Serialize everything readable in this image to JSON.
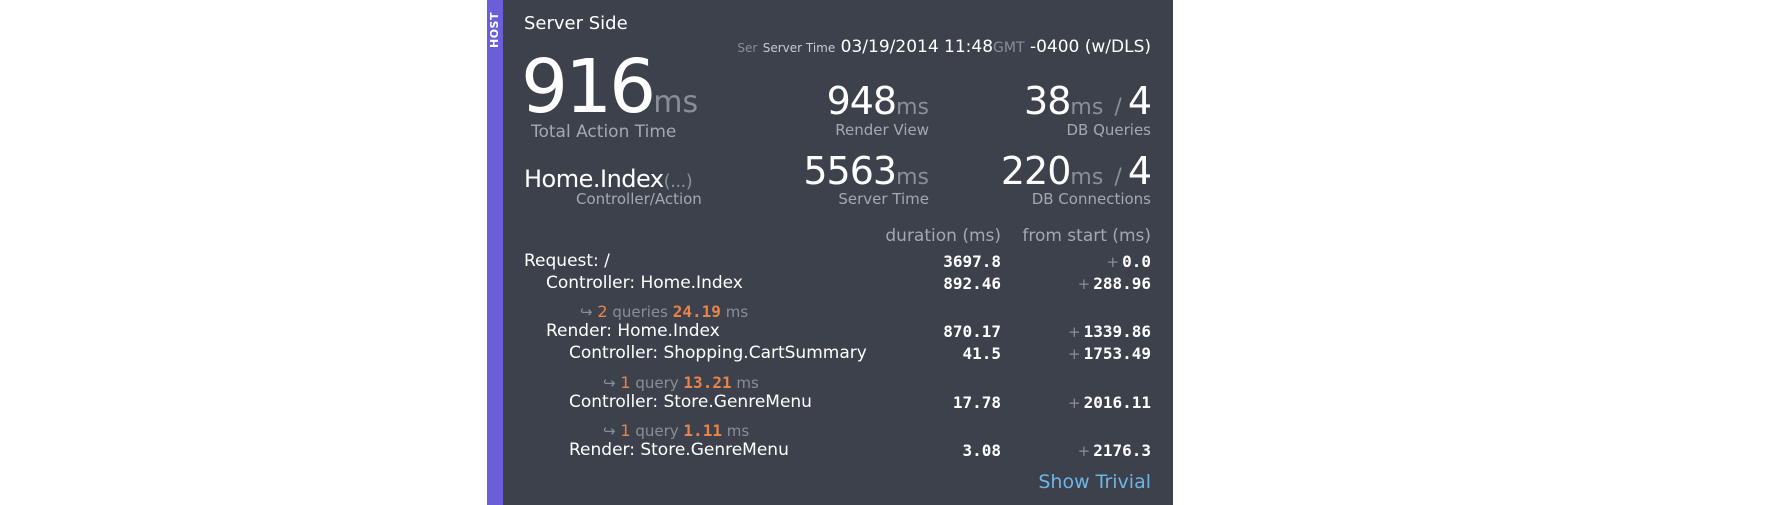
{
  "host_tab": {
    "label": "HOST"
  },
  "header": {
    "title": "Server Side",
    "server_time_abbr": "Ser",
    "server_time_label": "Server Time",
    "server_time_value": "03/19/2014 11:48",
    "server_time_tz": "GMT",
    "server_time_offset": "-0400",
    "server_time_dls": "(w/DLS)"
  },
  "metrics": {
    "total_action": {
      "value": "916",
      "unit": "ms",
      "label": "Total Action Time"
    },
    "render_view": {
      "value": "948",
      "unit": "ms",
      "label": "Render View"
    },
    "db_queries": {
      "value": "38",
      "unit": "ms",
      "separator": "/",
      "count": "4",
      "label": "DB Queries"
    },
    "action": {
      "name": "Home.Index",
      "args": "(...)",
      "label": "Controller/Action"
    },
    "server_time": {
      "value": "5563",
      "unit": "ms",
      "label": "Server Time"
    },
    "db_connections": {
      "value": "220",
      "unit": "ms",
      "separator": "/",
      "count": "4",
      "label": "DB Connections"
    }
  },
  "timeline": {
    "headers": {
      "duration": "duration (ms)",
      "from_start": "from start (ms)"
    },
    "rows": [
      {
        "label": "Request: /",
        "duration": "3697.8",
        "plus": "+",
        "from_start": "0.0"
      },
      {
        "label": "Controller: Home.Index",
        "duration": "892.46",
        "plus": "+",
        "from_start": "288.96"
      },
      {
        "label": "Render: Home.Index",
        "duration": "870.17",
        "plus": "+",
        "from_start": "1339.86"
      },
      {
        "label": "Controller: Shopping.CartSummary",
        "duration": "41.5",
        "plus": "+",
        "from_start": "1753.49"
      },
      {
        "label": "Controller: Store.GenreMenu",
        "duration": "17.78",
        "plus": "+",
        "from_start": "2016.11"
      },
      {
        "label": "Render: Store.GenreMenu",
        "duration": "3.08",
        "plus": "+",
        "from_start": "2176.3"
      }
    ],
    "queries": [
      {
        "arrow": "↪",
        "count": "2",
        "word": "queries",
        "ms_value": "24.19",
        "ms_unit": "ms"
      },
      {
        "arrow": "↪",
        "count": "1",
        "word": "query",
        "ms_value": "13.21",
        "ms_unit": "ms"
      },
      {
        "arrow": "↪",
        "count": "1",
        "word": "query",
        "ms_value": "1.11",
        "ms_unit": "ms"
      }
    ]
  },
  "footer": {
    "show_trivial": "Show Trivial"
  },
  "colors": {
    "panel_bg": "#3c414c",
    "host_tab": "#6a5fd8",
    "accent_orange": "#e8834a",
    "link_blue": "#6cb6e6"
  }
}
